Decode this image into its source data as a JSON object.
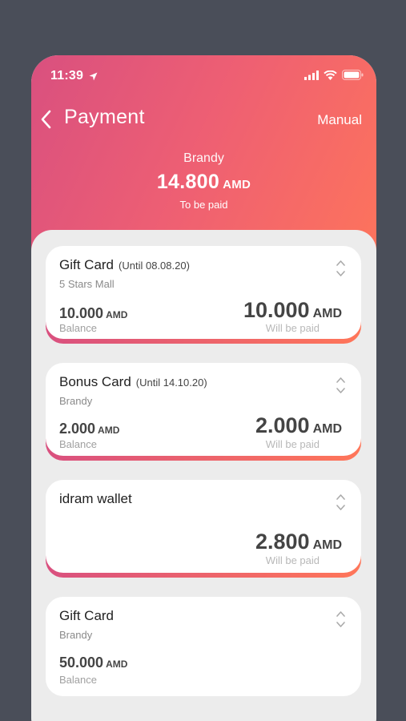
{
  "status_bar": {
    "time": "11:39"
  },
  "nav": {
    "title": "Payment",
    "manual_label": "Manual"
  },
  "summary": {
    "name": "Brandy",
    "amount": "14.800",
    "currency": "AMD",
    "note": "To be paid"
  },
  "cards": [
    {
      "title": "Gift Card",
      "until": "(Until 08.08.20)",
      "subtitle": "5 Stars Mall",
      "balance": "10.000",
      "balance_currency": "AMD",
      "balance_label": "Balance",
      "paid": "10.000",
      "paid_currency": "AMD",
      "paid_label": "Will be paid"
    },
    {
      "title": "Bonus Card",
      "until": "(Until 14.10.20)",
      "subtitle": "Brandy",
      "balance": "2.000",
      "balance_currency": "AMD",
      "balance_label": "Balance",
      "paid": "2.000",
      "paid_currency": "AMD",
      "paid_label": "Will be paid"
    },
    {
      "title": "idram wallet",
      "paid": "2.800",
      "paid_currency": "AMD",
      "paid_label": "Will be paid"
    },
    {
      "title": "Gift Card",
      "subtitle": "Brandy",
      "balance": "50.000",
      "balance_currency": "AMD",
      "balance_label": "Balance"
    }
  ],
  "colors": {
    "gradient_start": "#d9507f",
    "gradient_end": "#ff7659",
    "background": "#4a4e59",
    "sheet": "#ececec"
  },
  "icons": [
    "location-arrow-icon",
    "signal-icon",
    "wifi-icon",
    "battery-icon",
    "back-chevron-icon",
    "sort-chevrons-icon"
  ]
}
